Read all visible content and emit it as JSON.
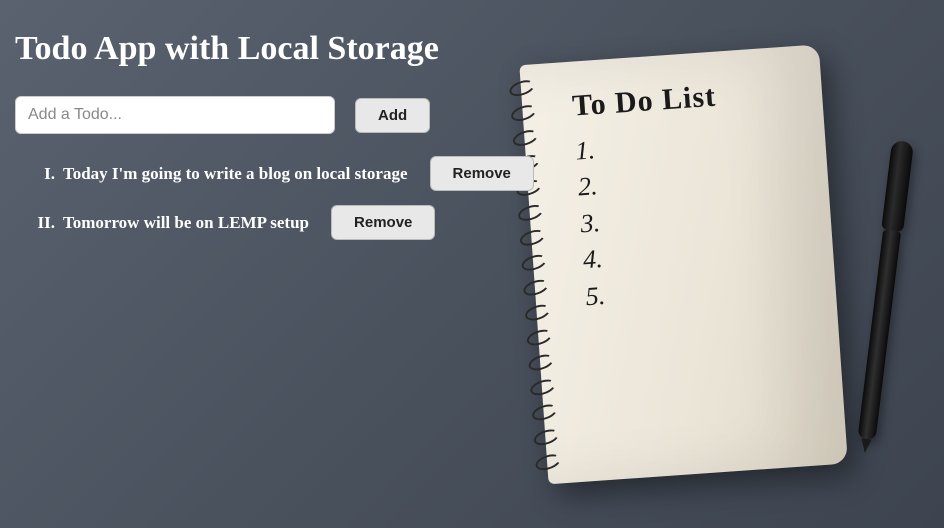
{
  "header": {
    "title": "Todo App with Local Storage"
  },
  "input": {
    "placeholder": "Add a Todo...",
    "value": ""
  },
  "buttons": {
    "add": "Add",
    "remove": "Remove"
  },
  "todos": [
    {
      "numeral": "I.",
      "text": "Today I'm going to write a blog on local storage"
    },
    {
      "numeral": "II.",
      "text": "Tomorrow will be on LEMP setup"
    }
  ],
  "notebook": {
    "title": "To Do List",
    "lines": [
      "1.",
      "2.",
      "3.",
      "4.",
      "5."
    ]
  }
}
